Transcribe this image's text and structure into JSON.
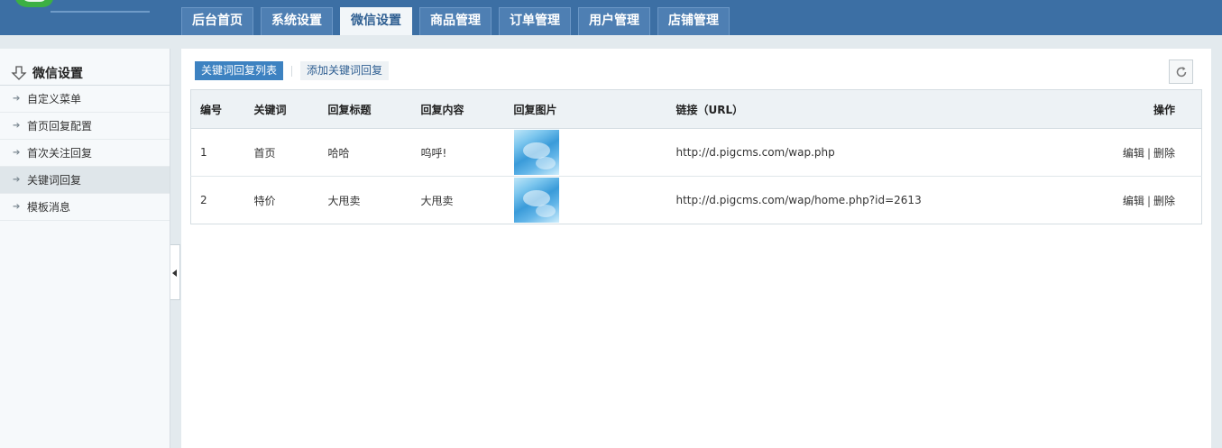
{
  "nav": {
    "tabs": [
      {
        "label": "后台首页"
      },
      {
        "label": "系统设置"
      },
      {
        "label": "微信设置",
        "active": true
      },
      {
        "label": "商品管理"
      },
      {
        "label": "订单管理"
      },
      {
        "label": "用户管理"
      },
      {
        "label": "店铺管理"
      }
    ]
  },
  "sidebar": {
    "title": "微信设置",
    "items": [
      {
        "label": "自定义菜单"
      },
      {
        "label": "首页回复配置"
      },
      {
        "label": "首次关注回复"
      },
      {
        "label": "关键词回复",
        "active": true
      },
      {
        "label": "模板消息"
      }
    ]
  },
  "main": {
    "subtabs": [
      {
        "label": "关键词回复列表",
        "active": true
      },
      {
        "label": "添加关键词回复"
      }
    ],
    "table": {
      "headers": [
        "编号",
        "关键词",
        "回复标题",
        "回复内容",
        "回复图片",
        "链接（URL）",
        "操作"
      ],
      "rows": [
        {
          "id": "1",
          "keyword": "首页",
          "title": "哈哈",
          "content": "呜呼!",
          "url": "http://d.pigcms.com/wap.php",
          "edit": "编辑",
          "sep": "|",
          "delete": "删除"
        },
        {
          "id": "2",
          "keyword": "特价",
          "title": "大甩卖",
          "content": "大甩卖",
          "url": "http://d.pigcms.com/wap/home.php?id=2613",
          "edit": "编辑",
          "sep": "|",
          "delete": "删除"
        }
      ]
    }
  },
  "colors": {
    "topbar": "#3c6fa4",
    "active_subtab": "#3d82c1",
    "brand_green": "#3cb043"
  }
}
